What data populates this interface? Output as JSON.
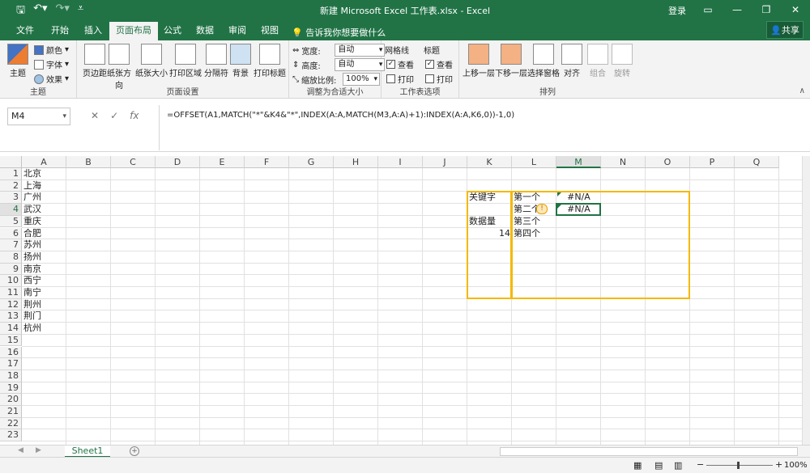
{
  "titlebar": {
    "title": "新建 Microsoft Excel 工作表.xlsx  -  Excel",
    "login": "登录",
    "save_icon": "save-icon",
    "undo_icon": "undo-icon",
    "redo_icon": "redo-icon",
    "customize_icon": "customize-qat-icon"
  },
  "tabs": [
    "文件",
    "开始",
    "插入",
    "页面布局",
    "公式",
    "数据",
    "审阅",
    "视图"
  ],
  "active_tab": "页面布局",
  "tellme": "告诉我你想要做什么",
  "share": "共享",
  "ribbon": {
    "theme_group": {
      "label": "主题",
      "theme": "主题",
      "colors": "颜色",
      "fonts": "字体",
      "effects": "效果"
    },
    "page_setup": {
      "label": "页面设置",
      "margins": "页边距",
      "orientation": "纸张方向",
      "size": "纸张大小",
      "print_area": "打印区域",
      "breaks": "分隔符",
      "background": "背景",
      "print_titles": "打印标题"
    },
    "scale": {
      "label": "调整为合适大小",
      "width_label": "宽度:",
      "width_value": "自动",
      "height_label": "高度:",
      "height_value": "自动",
      "scale_label": "缩放比例:",
      "scale_value": "100%"
    },
    "sheet_options": {
      "label": "工作表选项",
      "gridlines": "网格线",
      "headings": "标题",
      "view": "查看",
      "print": "打印"
    },
    "arrange": {
      "label": "排列",
      "bring_forward": "上移一层",
      "send_backward": "下移一层",
      "selection_pane": "选择窗格",
      "align": "对齐",
      "group": "组合",
      "rotate": "旋转"
    }
  },
  "formula_bar": {
    "name_box": "M4",
    "cancel": "✕",
    "enter": "✓",
    "fx": "fx",
    "formula": "=OFFSET(A1,MATCH(\"*\"&K4&\"*\",INDEX(A:A,MATCH(M3,A:A)+1):INDEX(A:A,K6,0))-1,0)"
  },
  "columns": [
    "A",
    "B",
    "C",
    "D",
    "E",
    "F",
    "G",
    "H",
    "I",
    "J",
    "K",
    "L",
    "M",
    "N",
    "O",
    "P",
    "Q"
  ],
  "rows": [
    "1",
    "2",
    "3",
    "4",
    "5",
    "6",
    "7",
    "8",
    "9",
    "10",
    "11",
    "12",
    "13",
    "14",
    "15",
    "16",
    "17",
    "18",
    "19",
    "20",
    "21",
    "22",
    "23"
  ],
  "cells": {
    "A": [
      "北京",
      "上海",
      "广州",
      "武汉",
      "重庆",
      "合肥",
      "苏州",
      "扬州",
      "南京",
      "西宁",
      "南宁",
      "荆州",
      "荆门",
      "杭州"
    ],
    "K3": "关键字",
    "K5": "数据量",
    "K6": "14",
    "L3": "第一个",
    "L4": "第二个",
    "L5": "第三个",
    "L6": "第四个",
    "M3": "#N/A",
    "M4": "#N/A"
  },
  "sheet_tab": "Sheet1",
  "status": {
    "zoom": "100%"
  }
}
